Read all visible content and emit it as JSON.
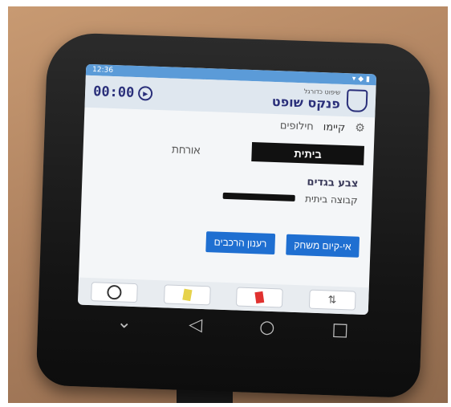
{
  "status_bar": {
    "time": "12:36",
    "right": "▾ ◆ ▮"
  },
  "header": {
    "subtitle": "שיפוט כדורגל",
    "title": "פנקס שופט",
    "timer": "00:00"
  },
  "tabs": [
    {
      "label": "קיימו"
    },
    {
      "label": "חילופים"
    }
  ],
  "teams": {
    "home": "ביתית",
    "away": "אורחת"
  },
  "kit_section": {
    "title": "צבע בגדים",
    "home_label": "קבוצה ביתית",
    "home_color": "#111111"
  },
  "actions": {
    "confirm": "אי-קיום משחק",
    "refresh": "רענון הרכבים"
  },
  "bottom_bar": {
    "subs_glyph": "⇅"
  },
  "nav": {
    "back": "◁",
    "home": "○",
    "recent": "□",
    "down": "⌄"
  }
}
